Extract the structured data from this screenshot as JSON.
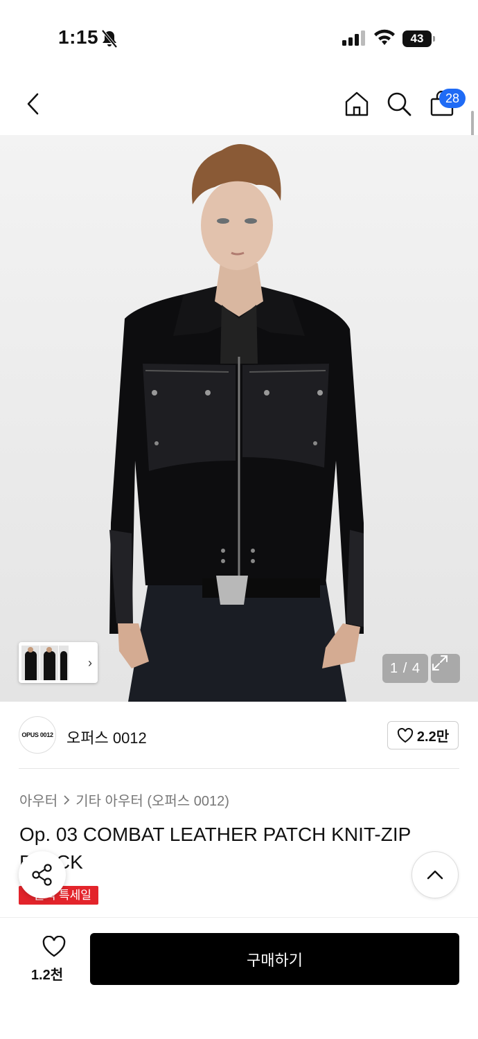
{
  "status_bar": {
    "time": "1:15",
    "battery": "43"
  },
  "header": {
    "cart_count": "28"
  },
  "gallery": {
    "counter": "1 / 4",
    "current_image": 1,
    "total_images": 4
  },
  "brand": {
    "logo_text": "OPUS 0012",
    "name": "오퍼스 0012",
    "like_count": "2.2만"
  },
  "breadcrumb": {
    "category": "아우터",
    "subcategory": "기타 아우터 (오퍼스 0012)"
  },
  "product": {
    "title": "Op. 03 COMBAT LEATHER PATCH KNIT-ZIP BLACK",
    "sale_badge": "블랙 특세일"
  },
  "bottom_bar": {
    "wish_count": "1.2천",
    "buy_label": "구매하기"
  },
  "colors": {
    "badge_blue": "#1f6bf5",
    "sale_red": "#e3242b",
    "buy_black": "#000000"
  }
}
